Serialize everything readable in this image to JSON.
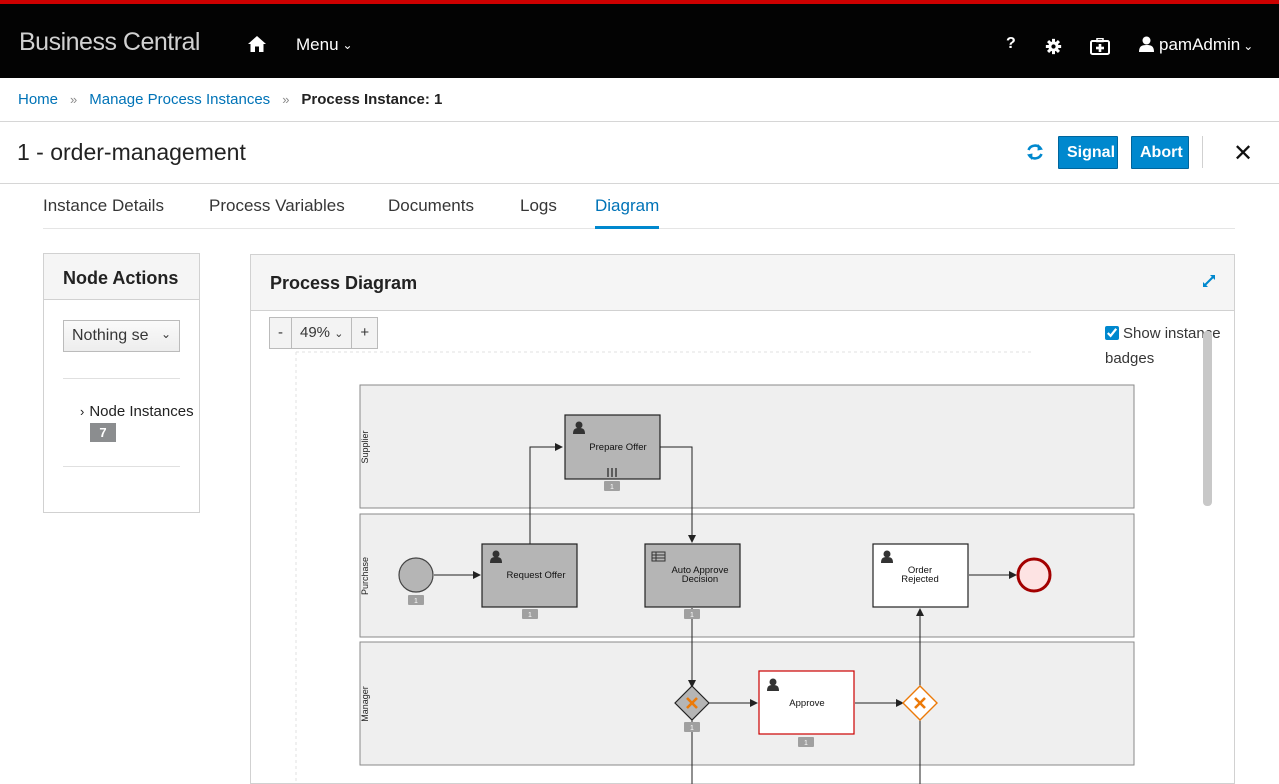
{
  "header": {
    "brand": "Business Central",
    "menu_label": "Menu",
    "help_label": "?",
    "user_label": "pamAdmin"
  },
  "breadcrumb": {
    "home": "Home",
    "manage": "Manage Process Instances",
    "current": "Process Instance: 1"
  },
  "page": {
    "title": "1 - order-management",
    "signal_label": "Signal",
    "abort_label": "Abort",
    "close_label": "✕"
  },
  "tabs": [
    {
      "label": "Instance Details"
    },
    {
      "label": "Process Variables"
    },
    {
      "label": "Documents"
    },
    {
      "label": "Logs"
    },
    {
      "label": "Diagram"
    }
  ],
  "node_actions": {
    "title": "Node Actions",
    "select_value": "Nothing se",
    "node_instances_label": "Node Instances",
    "node_instances_count": "7"
  },
  "diagram": {
    "title": "Process Diagram",
    "zoom_minus": "-",
    "zoom_value": "49%",
    "zoom_plus": "+",
    "show_badges_label": "Show instance badges",
    "show_badges_checked": true,
    "lanes": [
      "Supplier",
      "Purchase",
      "Manager"
    ],
    "tasks": {
      "prepare_offer": "Prepare Offer",
      "request_offer": "Request Offer",
      "auto_approve_1": "Auto Approve",
      "auto_approve_2": "Decision",
      "order_rejected_1": "Order",
      "order_rejected_2": "Rejected",
      "approve": "Approve"
    },
    "badge_count": "1",
    "colors": {
      "accent": "#0088ce",
      "completed_fill": "#b5b5b5",
      "active_border": "#cc0000",
      "gateway_orange": "#ec7a08"
    }
  }
}
